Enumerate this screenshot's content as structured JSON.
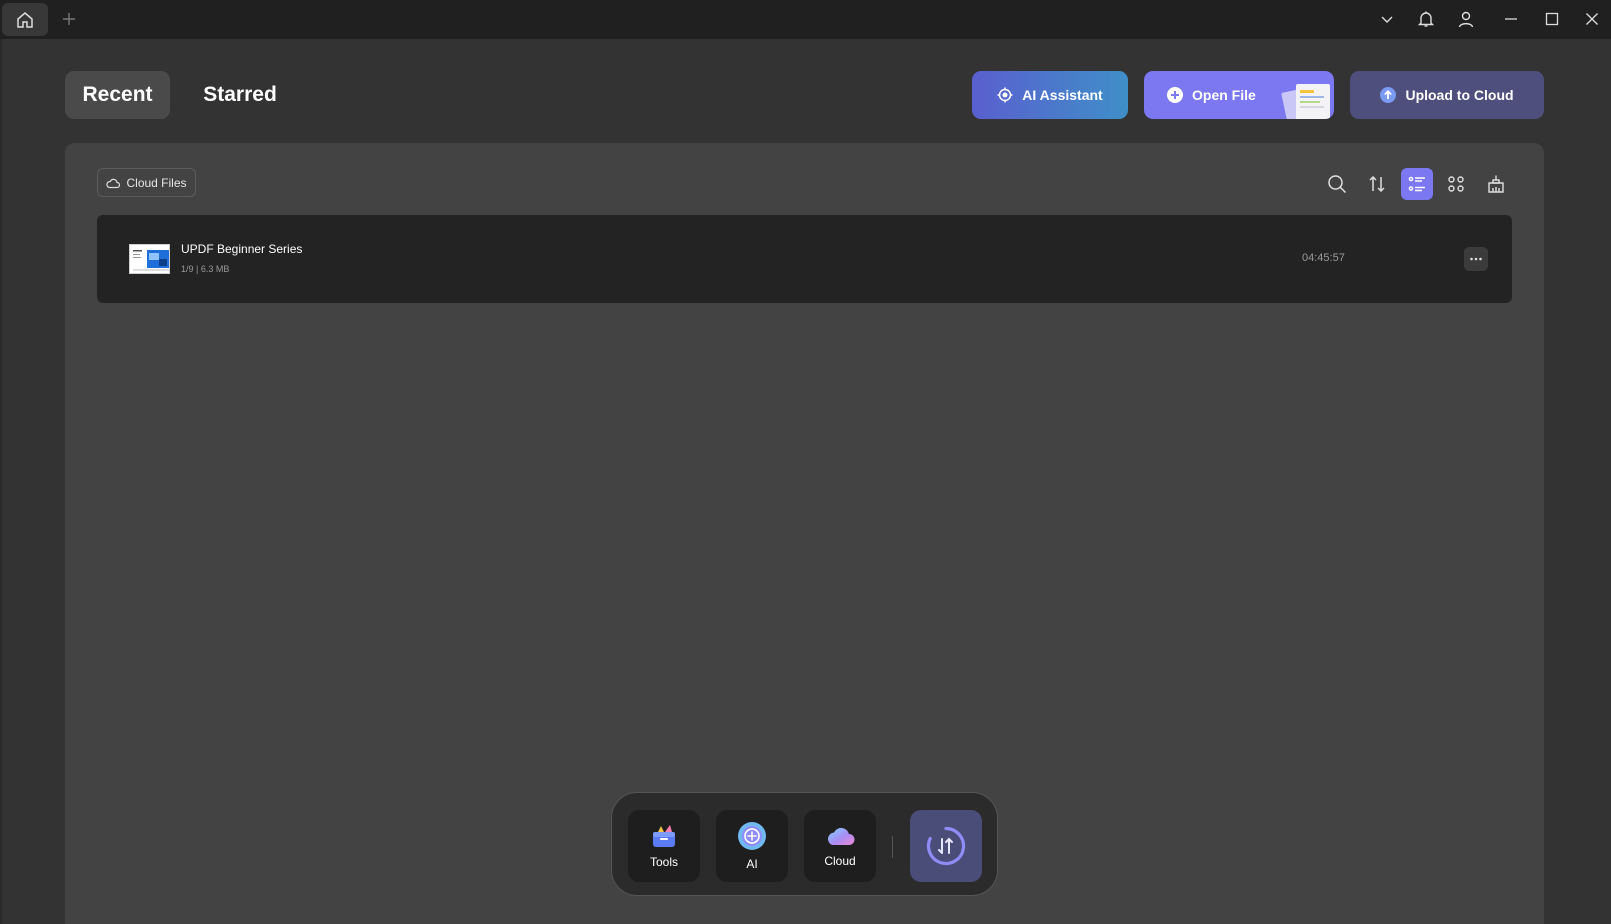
{
  "titlebar": {
    "icons": {
      "home": "home-icon",
      "new_tab": "plus-icon",
      "dropdown": "chevron-down-icon",
      "notifications": "bell-icon",
      "account": "user-icon",
      "minimize": "minimize-icon",
      "maximize": "maximize-icon",
      "close": "close-icon"
    }
  },
  "header": {
    "tabs": [
      {
        "label": "Recent",
        "active": true
      },
      {
        "label": "Starred",
        "active": false
      }
    ],
    "ai_assistant_label": "AI Assistant",
    "open_file_label": "Open File",
    "upload_label": "Upload to Cloud"
  },
  "toolbar": {
    "cloud_files_label": "Cloud Files",
    "icons": [
      "search-icon",
      "sort-icon",
      "list-view-icon",
      "grid-view-icon",
      "clear-icon"
    ],
    "active_view": "list"
  },
  "files": [
    {
      "name": "UPDF Beginner Series",
      "meta": "1/9 | 6.3 MB",
      "time": "04:45:57"
    }
  ],
  "dock": {
    "items": [
      {
        "label": "Tools",
        "icon": "tools-icon"
      },
      {
        "label": "AI",
        "icon": "ai-icon"
      },
      {
        "label": "Cloud",
        "icon": "cloud-icon"
      }
    ],
    "convert_icon": "convert-icon"
  },
  "colors": {
    "accent": "#7b78f2",
    "background": "#333333",
    "panel": "#434343",
    "titlebar": "#202020"
  }
}
